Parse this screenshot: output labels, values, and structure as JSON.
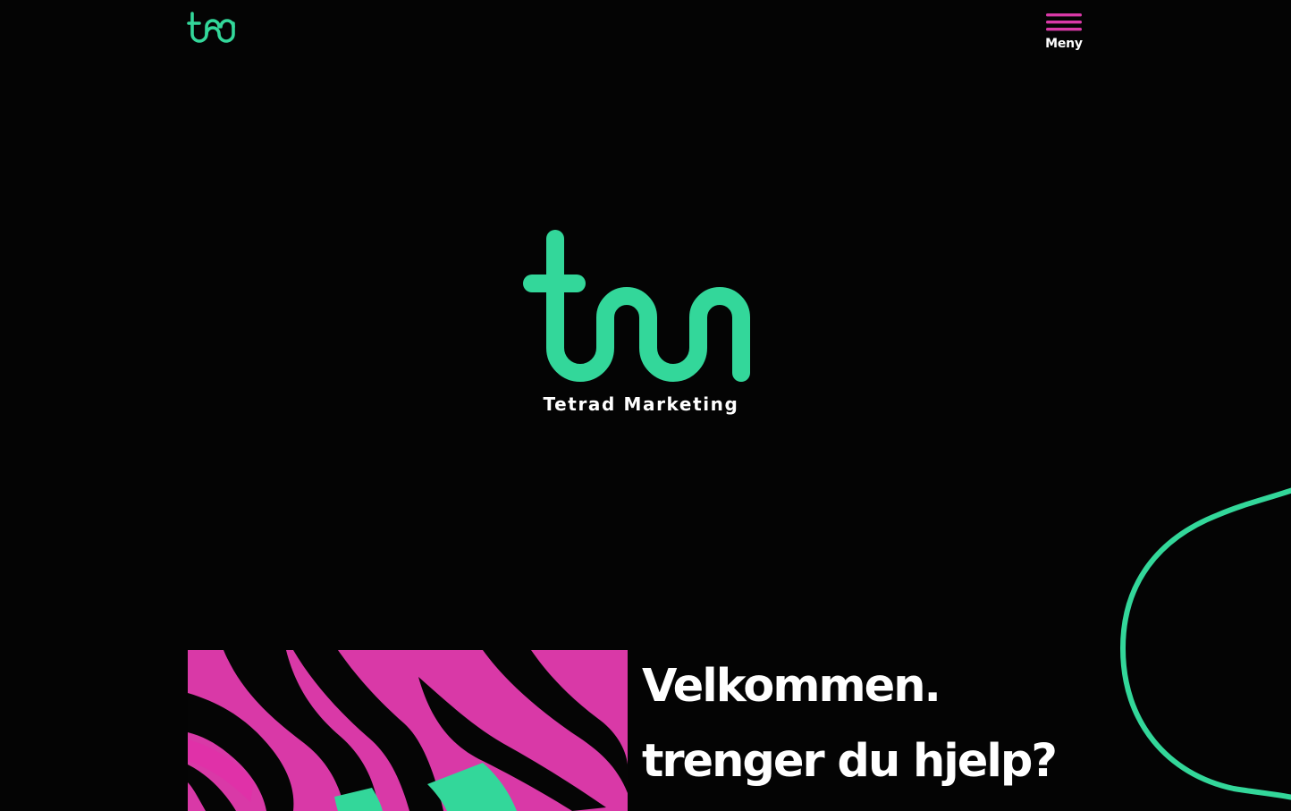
{
  "header": {
    "logo_icon": "tm-logo-icon",
    "menu_icon": "hamburger-icon",
    "menu_label": "Meny"
  },
  "hero": {
    "logo_icon": "tm-logo-icon",
    "brand_name": "Tetrad Marketing"
  },
  "intro": {
    "image": "zebra-pattern-image",
    "headline_line1": "Velkommen.",
    "headline_line2": "trenger du hjelp?"
  },
  "colors": {
    "background": "#040404",
    "brand_green": "#33d79a",
    "brand_pink": "#d939a7",
    "text": "#ffffff"
  }
}
